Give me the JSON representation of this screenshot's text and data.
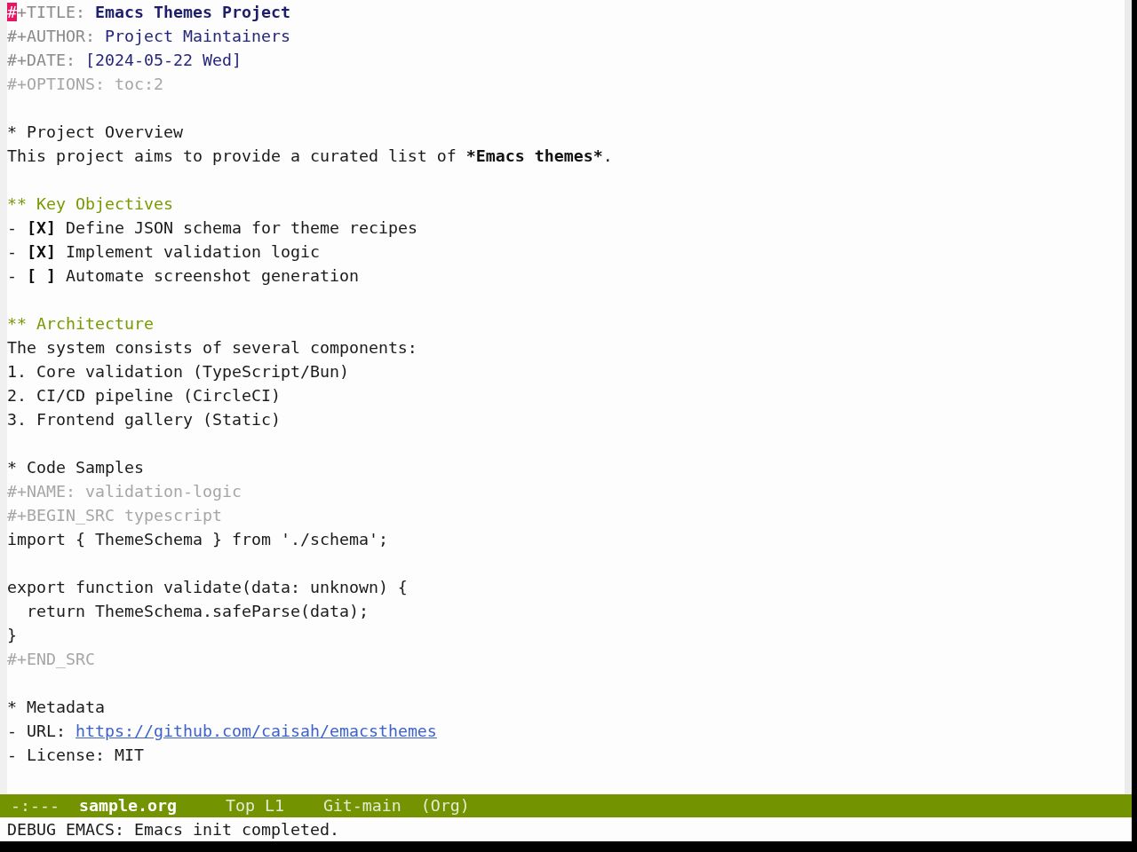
{
  "editor": {
    "preamble": [
      {
        "kind": "keyword",
        "segments": [
          {
            "kind": "cursor",
            "text": "#"
          },
          {
            "kind": "keyword",
            "text": "+TITLE: "
          },
          {
            "kind": "title",
            "text": "Emacs Themes Project"
          }
        ]
      },
      {
        "kind": "keyword",
        "segments": [
          {
            "kind": "keyword",
            "text": "#+AUTHOR: "
          },
          {
            "kind": "value",
            "text": "Project Maintainers"
          }
        ]
      },
      {
        "kind": "keyword",
        "segments": [
          {
            "kind": "keyword",
            "text": "#+DATE: "
          },
          {
            "kind": "value",
            "text": "[2024-05-22 Wed]"
          }
        ]
      },
      {
        "kind": "meta",
        "text": "#+OPTIONS: toc:2"
      },
      {
        "kind": "blank"
      }
    ],
    "sections": [
      {
        "heading": "* Project Overview",
        "body": [
          {
            "kind": "paragraph",
            "segments": [
              {
                "kind": "plain",
                "text": "This project aims to provide a curated list of "
              },
              {
                "kind": "bold",
                "text": "*Emacs themes*"
              },
              {
                "kind": "plain",
                "text": "."
              }
            ]
          },
          {
            "kind": "blank"
          }
        ],
        "children": [
          {
            "heading": "** Key Objectives",
            "body": [
              {
                "kind": "checkbox_item",
                "segments": [
                  {
                    "kind": "plain",
                    "text": "- "
                  },
                  {
                    "kind": "checkbox",
                    "text": "[X]"
                  },
                  {
                    "kind": "plain",
                    "text": " Define JSON schema for theme recipes"
                  }
                ]
              },
              {
                "kind": "checkbox_item",
                "segments": [
                  {
                    "kind": "plain",
                    "text": "- "
                  },
                  {
                    "kind": "checkbox",
                    "text": "[X]"
                  },
                  {
                    "kind": "plain",
                    "text": " Implement validation logic"
                  }
                ]
              },
              {
                "kind": "checkbox_item",
                "segments": [
                  {
                    "kind": "plain",
                    "text": "- "
                  },
                  {
                    "kind": "checkbox",
                    "text": "[ ]"
                  },
                  {
                    "kind": "plain",
                    "text": " Automate screenshot generation"
                  }
                ]
              },
              {
                "kind": "blank"
              }
            ]
          },
          {
            "heading": "** Architecture",
            "body": [
              {
                "kind": "paragraph",
                "text": "The system consists of several components:"
              },
              {
                "kind": "list_item",
                "text": "1. Core validation (TypeScript/Bun)"
              },
              {
                "kind": "list_item",
                "text": "2. CI/CD pipeline (CircleCI)"
              },
              {
                "kind": "list_item",
                "text": "3. Frontend gallery (Static)"
              },
              {
                "kind": "blank"
              }
            ]
          }
        ]
      },
      {
        "heading": "* Code Samples",
        "body": [
          {
            "kind": "meta",
            "text": "#+NAME: validation-logic"
          },
          {
            "kind": "meta",
            "text": "#+BEGIN_SRC typescript"
          },
          {
            "kind": "code",
            "text": "import { ThemeSchema } from './schema';"
          },
          {
            "kind": "blank"
          },
          {
            "kind": "code",
            "text": "export function validate(data: unknown) {"
          },
          {
            "kind": "code",
            "text": "  return ThemeSchema.safeParse(data);"
          },
          {
            "kind": "code",
            "text": "}"
          },
          {
            "kind": "meta",
            "text": "#+END_SRC"
          },
          {
            "kind": "blank"
          }
        ]
      },
      {
        "heading": "* Metadata",
        "body": [
          {
            "kind": "list_item",
            "segments": [
              {
                "kind": "plain",
                "text": "- URL: "
              },
              {
                "kind": "link",
                "text": "https://github.com/caisah/emacsthemes"
              }
            ]
          },
          {
            "kind": "list_item",
            "text": "- License: MIT"
          }
        ]
      }
    ]
  },
  "mode_line": {
    "state": "-:---",
    "buffer_name": "sample.org",
    "position": "Top L1",
    "vc_branch": "Git-main",
    "major_mode": "(Org)"
  },
  "echo_area": {
    "text": "DEBUG EMACS: Emacs init completed."
  }
}
